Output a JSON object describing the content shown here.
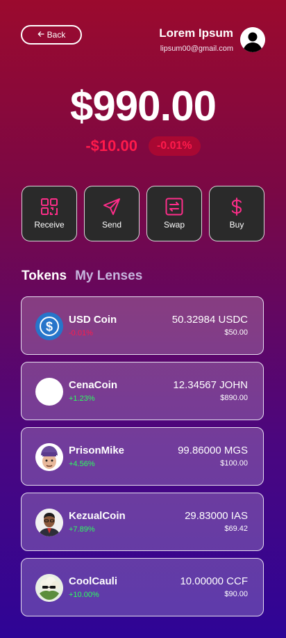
{
  "header": {
    "back_label": "Back",
    "user_name": "Lorem Ipsum",
    "user_email": "lipsum00@gmail.com"
  },
  "balance": {
    "total": "$990.00",
    "change_amount": "-$10.00",
    "change_percent": "-0.01%"
  },
  "actions": [
    {
      "label": "Receive",
      "icon": "qr-code-icon"
    },
    {
      "label": "Send",
      "icon": "send-icon"
    },
    {
      "label": "Swap",
      "icon": "swap-icon"
    },
    {
      "label": "Buy",
      "icon": "dollar-icon"
    }
  ],
  "tabs": [
    {
      "label": "Tokens",
      "active": true
    },
    {
      "label": "My Lenses",
      "active": false
    }
  ],
  "tokens": [
    {
      "name": "USD Coin",
      "change": "-0.01%",
      "amount": "50.32984 USDC",
      "value": "$50.00",
      "logo": "usdc-logo"
    },
    {
      "name": "CenaCoin",
      "change": "+1.23%",
      "amount": "12.34567 JOHN",
      "value": "$890.00",
      "logo": "blank-logo"
    },
    {
      "name": "PrisonMike",
      "change": "+4.56%",
      "amount": "99.86000 MGS",
      "value": "$100.00",
      "logo": "prisonmike-logo"
    },
    {
      "name": "KezualCoin",
      "change": "+7.89%",
      "amount": "29.83000 IAS",
      "value": "$69.42",
      "logo": "kezual-logo"
    },
    {
      "name": "CoolCauli",
      "change": "+10.00%",
      "amount": "10.00000 CCF",
      "value": "$90.00",
      "logo": "coolcauli-logo"
    }
  ],
  "colors": {
    "accent_pink": "#ff2d8a",
    "negative": "#ff1a4b",
    "positive": "#2bff5e"
  }
}
